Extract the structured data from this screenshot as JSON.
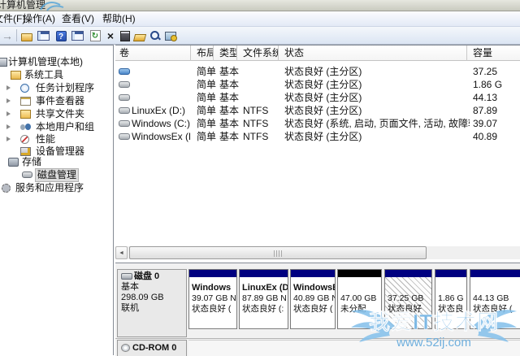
{
  "window": {
    "title": "计算机管理"
  },
  "menu": {
    "items": [
      "文件(F)",
      "操作(A)",
      "查看(V)",
      "帮助(H)"
    ]
  },
  "toolbar": {
    "forward_glyph": "→",
    "help_glyph": "?",
    "refresh_glyph": "↻",
    "delete_glyph": "×",
    "icons": [
      "forward-icon",
      "show-console-tree-icon",
      "console-window-icon",
      "help-icon",
      "console-window-alt-icon",
      "refresh-icon",
      "delete-icon",
      "properties-icon",
      "open-icon",
      "find-icon",
      "manage-computer-icon"
    ]
  },
  "sidebar": {
    "items": [
      {
        "label": "计算机管理(本地)"
      },
      {
        "label": "系统工具"
      },
      {
        "label": "任务计划程序"
      },
      {
        "label": "事件查看器"
      },
      {
        "label": "共享文件夹"
      },
      {
        "label": "本地用户和组"
      },
      {
        "label": "性能"
      },
      {
        "label": "设备管理器"
      },
      {
        "label": "存储"
      },
      {
        "label": "磁盘管理"
      },
      {
        "label": "服务和应用程序"
      }
    ],
    "selected": "磁盘管理"
  },
  "volume_table": {
    "columns": [
      "卷",
      "布局",
      "类型",
      "文件系统",
      "状态",
      "容量"
    ],
    "rows": [
      {
        "name": "",
        "layout": "简单",
        "type": "基本",
        "fs": "",
        "status": "状态良好 (主分区)",
        "capacity": "37.25"
      },
      {
        "name": "",
        "layout": "简单",
        "type": "基本",
        "fs": "",
        "status": "状态良好 (主分区)",
        "capacity": "1.86 G"
      },
      {
        "name": "",
        "layout": "简单",
        "type": "基本",
        "fs": "",
        "status": "状态良好 (主分区)",
        "capacity": "44.13"
      },
      {
        "name": "LinuxEx (D:)",
        "layout": "简单",
        "type": "基本",
        "fs": "NTFS",
        "status": "状态良好 (主分区)",
        "capacity": "87.89"
      },
      {
        "name": "Windows (C:)",
        "layout": "简单",
        "type": "基本",
        "fs": "NTFS",
        "status": "状态良好 (系统, 启动, 页面文件, 活动, 故障转储, 主分区)",
        "capacity": "39.07"
      },
      {
        "name": "WindowsEx (E:)",
        "layout": "简单",
        "type": "基本",
        "fs": "NTFS",
        "status": "状态良好 (主分区)",
        "capacity": "40.89"
      }
    ]
  },
  "scrollbar": {
    "left_glyph": "◄"
  },
  "disk0": {
    "name": "磁盘 0",
    "type": "基本",
    "size": "298.09 GB",
    "status": "联机",
    "partitions": [
      {
        "name": "Windows",
        "size": "39.07 GB N",
        "status": "状态良好 ("
      },
      {
        "name": "LinuxEx (D",
        "size": "87.89 GB N",
        "status": "状态良好 (:"
      },
      {
        "name": "WindowsE",
        "size": "40.89 GB N",
        "status": "状态良好 ("
      },
      {
        "name": "",
        "size": "47.00 GB",
        "status": "未分配"
      },
      {
        "name": "",
        "size": "37.25 GB",
        "status": "状态良好"
      },
      {
        "name": "",
        "size": "1.86 G",
        "status": "状态良"
      },
      {
        "name": "",
        "size": "44.13 GB",
        "status": "状态良好 ("
      }
    ]
  },
  "cdrom": {
    "label": "CD-ROM 0"
  },
  "watermark": {
    "site_name": "我爱IT技术网",
    "site_url": "www.52ij.com"
  },
  "colors": {
    "partition_bar": "#000080",
    "unallocated_bar": "#000000",
    "watermark_blue": "#6fb0e0"
  }
}
